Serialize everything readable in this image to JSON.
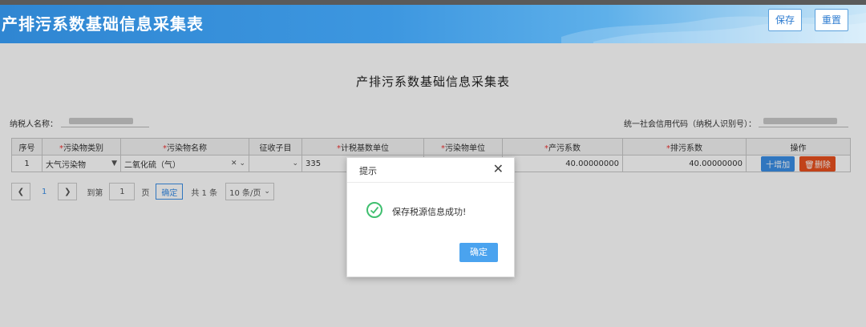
{
  "header": {
    "title": "产排污系数基础信息采集表",
    "save_label": "保存",
    "reset_label": "重置"
  },
  "page": {
    "heading": "产排污系数基础信息采集表",
    "taxpayer_label": "纳税人名称：",
    "credit_code_label": "统一社会信用代码（纳税人识别号）："
  },
  "table": {
    "columns": [
      "序号",
      "污染物类别",
      "污染物名称",
      "征收子目",
      "计税基数单位",
      "污染物单位",
      "产污系数",
      "排污系数",
      "操作"
    ],
    "rows": [
      {
        "index": "1",
        "category": "大气污染物",
        "pollutant": "二氧化硫（气）",
        "subitem": "",
        "tax_unit": "335",
        "pollutant_unit": "",
        "production_coef": "40.00000000",
        "emission_coef": "40.00000000",
        "add_label": "十增加",
        "delete_label": "删除"
      }
    ]
  },
  "pager": {
    "prev_icon": "chevron-left-icon",
    "current_page": "1",
    "next_icon": "chevron-right-icon",
    "goto_label": "到第",
    "goto_value": "1",
    "page_unit": "页",
    "confirm_label": "确定",
    "total_label": "共 1 条",
    "page_size": "10 条/页"
  },
  "dialog": {
    "title": "提示",
    "message": "保存税源信息成功!",
    "ok_label": "确定",
    "close_icon": "close-icon",
    "status_icon": "success-check-icon"
  },
  "colors": {
    "header_blue": "#3d97e0",
    "accent_blue": "#3a8ee6",
    "required_red": "#e33333",
    "delete_orange": "#e8501f",
    "success_green": "#3fbf6f"
  }
}
